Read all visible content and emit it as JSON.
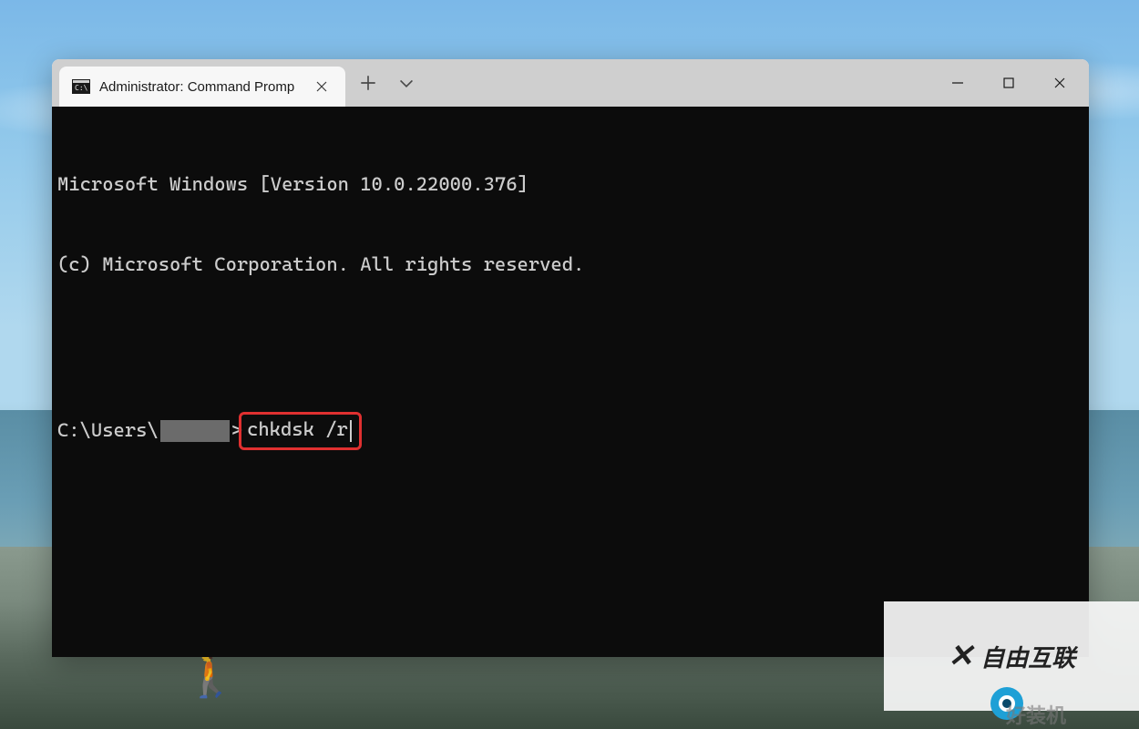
{
  "window": {
    "tab_title": "Administrator: Command Promp",
    "tab_icon_name": "cmd-icon"
  },
  "terminal": {
    "line1": "Microsoft Windows [Version 10.0.22000.376]",
    "line2": "(c) Microsoft Corporation. All rights reserved.",
    "prompt_prefix": "C:\\Users\\",
    "prompt_suffix": ">",
    "command": "chkdsk /r"
  },
  "watermark": {
    "text": "自由互联",
    "secondary": "好装机"
  }
}
